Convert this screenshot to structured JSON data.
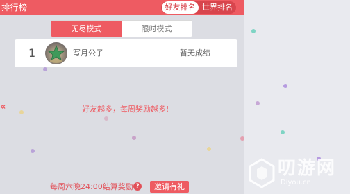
{
  "header": {
    "title": "排行榜",
    "tabs": [
      "好友排名",
      "世界排名"
    ],
    "active_tab": "好友排名",
    "color": "#ee5b62"
  },
  "modes": {
    "tabs": [
      "无尽模式",
      "限时模式"
    ],
    "active": "无尽模式"
  },
  "leaderboard": [
    {
      "rank": "1",
      "name": "写月公子",
      "score": "暂无成绩",
      "avatar_icon": "green-star-avatar-icon"
    }
  ],
  "slogan": "好友越多，每周奖励越多!",
  "chevron_icon": "«",
  "footer": {
    "text": "每周六晚24:00结算奖励",
    "info_icon": "?",
    "invite_label": "邀请有礼"
  },
  "watermark": {
    "text": "叨游网",
    "sub": "Diyou.cn"
  }
}
